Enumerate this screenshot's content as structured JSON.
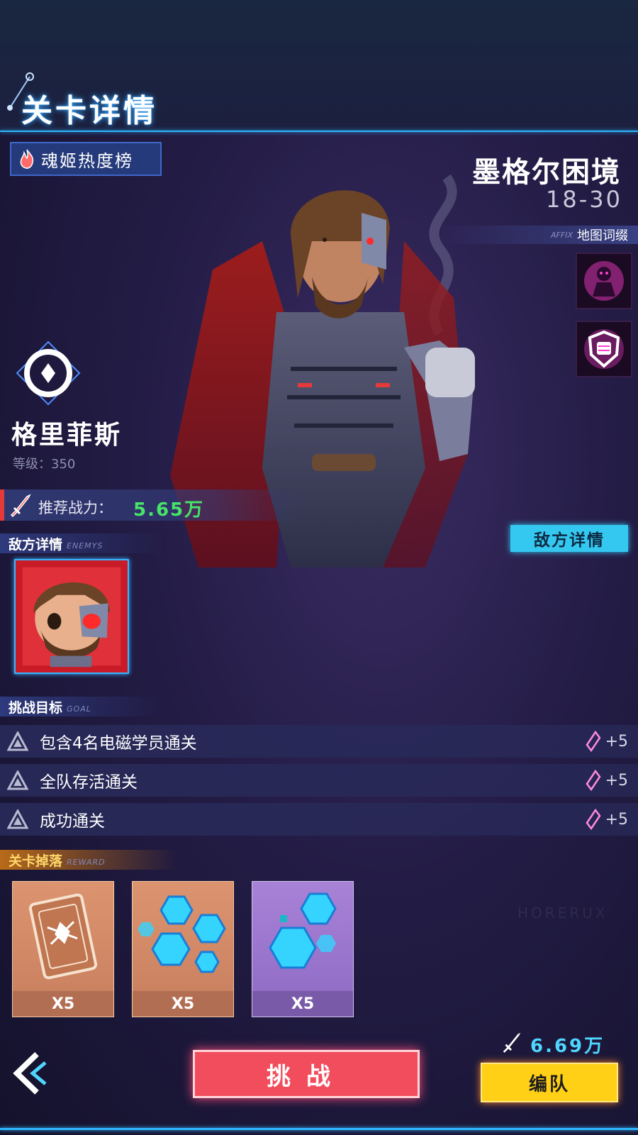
{
  "header": {
    "title": "关卡详情"
  },
  "heat_rank": {
    "label": "魂姬热度榜",
    "icon": "flame-icon"
  },
  "map": {
    "name": "墨格尔困境",
    "range": "18-30",
    "affix_en": "AFFIX",
    "affix_label": "地图词缀",
    "affixes": [
      {
        "icon": "doll-icon"
      },
      {
        "icon": "fist-shield-icon"
      }
    ]
  },
  "boss": {
    "name": "格里菲斯",
    "level": "等级：350"
  },
  "power": {
    "label": "推荐战力：",
    "value": "5.65万"
  },
  "enemy_section": {
    "cn": "敌方详情",
    "en": "ENEMYS"
  },
  "enemy_detail_button": "敌方详情",
  "goal_section": {
    "cn": "挑战目标",
    "en": "GOAL"
  },
  "goals": [
    {
      "text": "包含4名电磁学员通关",
      "reward": "+5"
    },
    {
      "text": "全队存活通关",
      "reward": "+5"
    },
    {
      "text": "成功通关",
      "reward": "+5"
    }
  ],
  "reward_section": {
    "cn": "关卡掉落",
    "en": "REWARD"
  },
  "rewards": [
    {
      "icon": "card-item-icon",
      "count": "X5"
    },
    {
      "icon": "blue-crystals-icon",
      "count": "X5"
    },
    {
      "icon": "purple-crystals-icon",
      "count": "X5"
    }
  ],
  "my_power": "6.69万",
  "buttons": {
    "challenge": "挑战",
    "team": "编队"
  },
  "watermark": "HORERUX",
  "colors": {
    "accent": "#2fb7ff",
    "power_green": "#48e36a",
    "challenge": "#f24d5d",
    "team": "#ffd016"
  }
}
